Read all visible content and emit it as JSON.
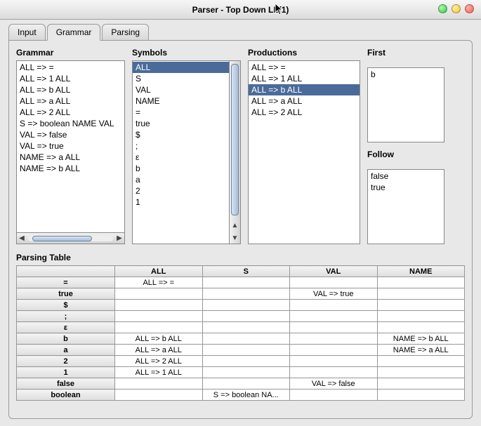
{
  "window": {
    "title": "Parser - Top Down LL(1)"
  },
  "tabs": [
    {
      "label": "Input",
      "active": false
    },
    {
      "label": "Grammar",
      "active": true
    },
    {
      "label": "Parsing",
      "active": false
    }
  ],
  "labels": {
    "grammar": "Grammar",
    "symbols": "Symbols",
    "productions": "Productions",
    "first": "First",
    "follow": "Follow",
    "parsing_table": "Parsing Table"
  },
  "grammar": {
    "items": [
      "ALL => =",
      "ALL => 1 ALL",
      "ALL => b ALL",
      "ALL => a ALL",
      "ALL => 2 ALL",
      "S => boolean NAME VAL",
      "VAL => false",
      "VAL => true",
      "NAME => a ALL",
      "NAME => b ALL"
    ]
  },
  "symbols": {
    "items": [
      "ALL",
      "S",
      "VAL",
      "NAME",
      "=",
      "true",
      "$",
      ";",
      "ε",
      "b",
      "a",
      "2",
      "1"
    ],
    "selected_index": 0
  },
  "productions": {
    "items": [
      "ALL => =",
      "ALL => 1 ALL",
      "ALL => b ALL",
      "ALL => a ALL",
      "ALL => 2 ALL"
    ],
    "selected_index": 2
  },
  "first": {
    "items": [
      "b"
    ]
  },
  "follow": {
    "items": [
      "false",
      "true"
    ]
  },
  "parsing_table": {
    "columns": [
      "ALL",
      "S",
      "VAL",
      "NAME"
    ],
    "rows": [
      {
        "head": "=",
        "cells": [
          "ALL => =",
          "",
          "",
          ""
        ]
      },
      {
        "head": "true",
        "cells": [
          "",
          "",
          "VAL => true",
          ""
        ]
      },
      {
        "head": "$",
        "cells": [
          "",
          "",
          "",
          ""
        ]
      },
      {
        "head": ";",
        "cells": [
          "",
          "",
          "",
          ""
        ]
      },
      {
        "head": "ε",
        "cells": [
          "",
          "",
          "",
          ""
        ]
      },
      {
        "head": "b",
        "cells": [
          "ALL => b ALL",
          "",
          "",
          "NAME => b ALL"
        ]
      },
      {
        "head": "a",
        "cells": [
          "ALL => a ALL",
          "",
          "",
          "NAME => a ALL"
        ]
      },
      {
        "head": "2",
        "cells": [
          "ALL => 2 ALL",
          "",
          "",
          ""
        ]
      },
      {
        "head": "1",
        "cells": [
          "ALL => 1 ALL",
          "",
          "",
          ""
        ]
      },
      {
        "head": "false",
        "cells": [
          "",
          "",
          "VAL => false",
          ""
        ]
      },
      {
        "head": "boolean",
        "cells": [
          "",
          "S => boolean NA...",
          "",
          ""
        ]
      }
    ]
  }
}
